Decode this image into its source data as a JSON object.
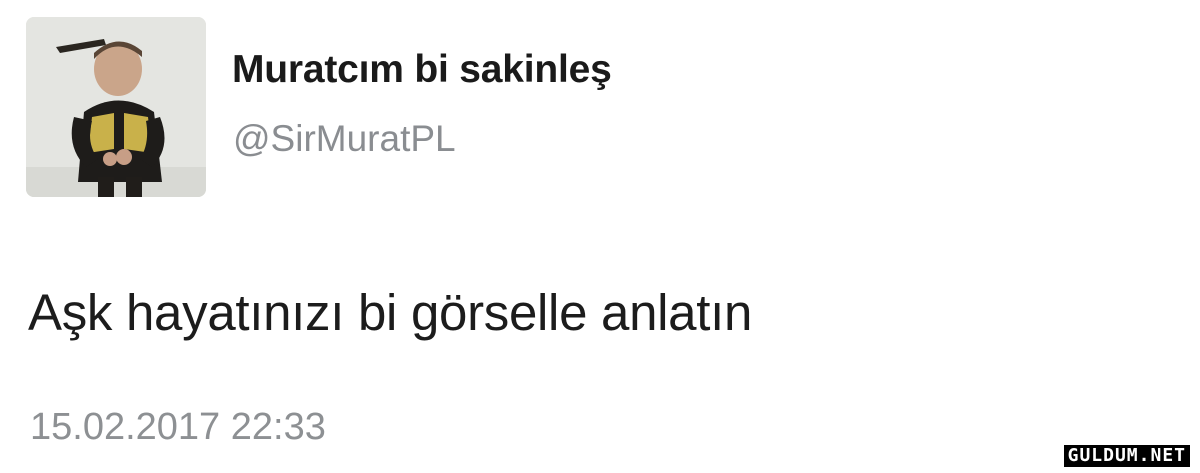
{
  "tweet": {
    "display_name": "Muratcım bi sakinleş",
    "handle": "@SirMuratPL",
    "text": "Aşk hayatınızı bi görselle anlatın",
    "timestamp": "15.02.2017 22:33"
  },
  "avatar": {
    "description_icon": "profile-photo"
  },
  "watermark": {
    "text": "GULDUM.NET"
  },
  "colors": {
    "name": "#1a1a1a",
    "handle": "#8a8d91",
    "text": "#1c1c1c",
    "timestamp": "#8d9093",
    "background": "#ffffff"
  }
}
